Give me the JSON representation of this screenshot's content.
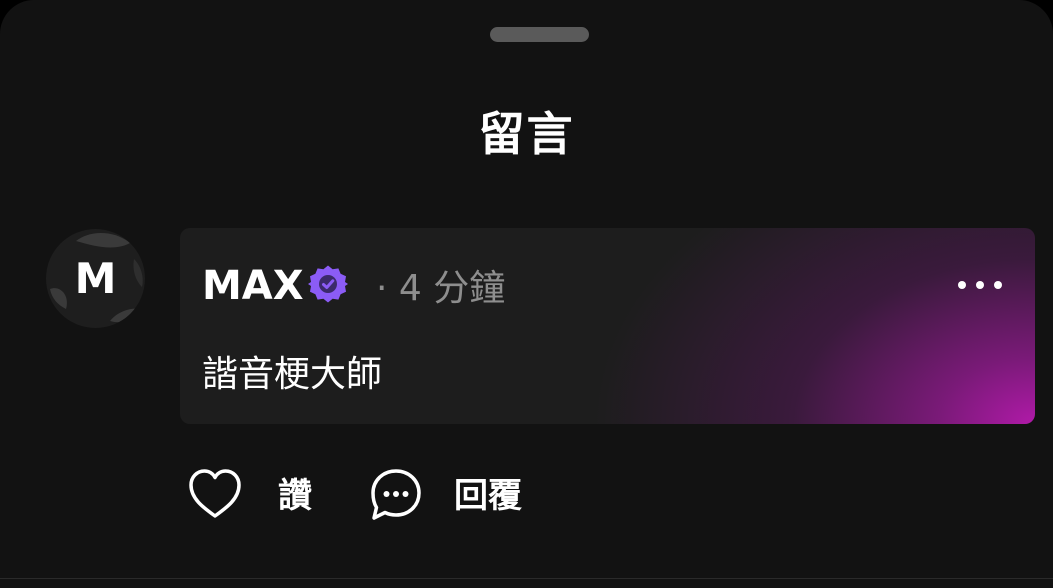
{
  "sheet": {
    "title": "留言"
  },
  "comment": {
    "avatar_letter": "M",
    "author": "MAX",
    "verified_icon": "verified-badge-icon",
    "timestamp": "· 4 分鐘",
    "text": "諧音梗大師",
    "more_icon": "more-dots-icon"
  },
  "actions": {
    "like_label": "讚",
    "like_icon": "heart-icon",
    "reply_label": "回覆",
    "reply_icon": "chat-bubble-icon"
  },
  "colors": {
    "background": "#121212",
    "card": "#1d1d1d",
    "accent_gradient": "#b01aa8",
    "verified": "#8b5cf6",
    "muted_text": "#8e8e8e"
  }
}
